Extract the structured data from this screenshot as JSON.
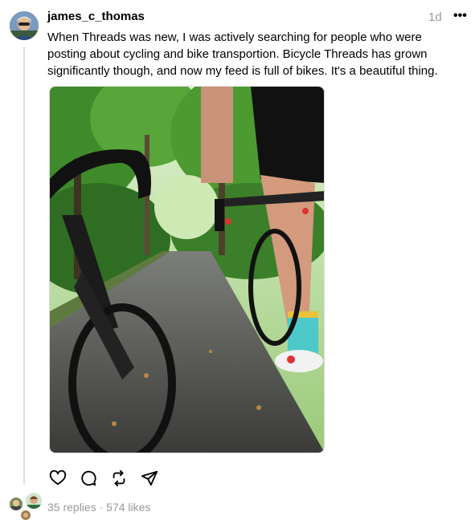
{
  "post": {
    "username": "james_c_thomas",
    "timestamp": "1d",
    "more_icon": "more-horizontal-icon",
    "text": "When Threads was new, I was actively searching for people who were posting about cycling and bike transportion. Bicycle Threads has grown significantly though, and now my feed is full of bikes. It's a beautiful thing.",
    "image_alt": "First-person view of riding a road bike on a forest path behind another cyclist"
  },
  "actions": [
    {
      "icon": "heart-icon"
    },
    {
      "icon": "comment-icon"
    },
    {
      "icon": "repost-icon"
    },
    {
      "icon": "share-icon"
    }
  ],
  "stats": {
    "replies": "35 replies",
    "separator": "·",
    "likes": "574 likes"
  },
  "colors": {
    "text": "#000000",
    "secondary": "#999999",
    "line": "#e0e0e0"
  }
}
